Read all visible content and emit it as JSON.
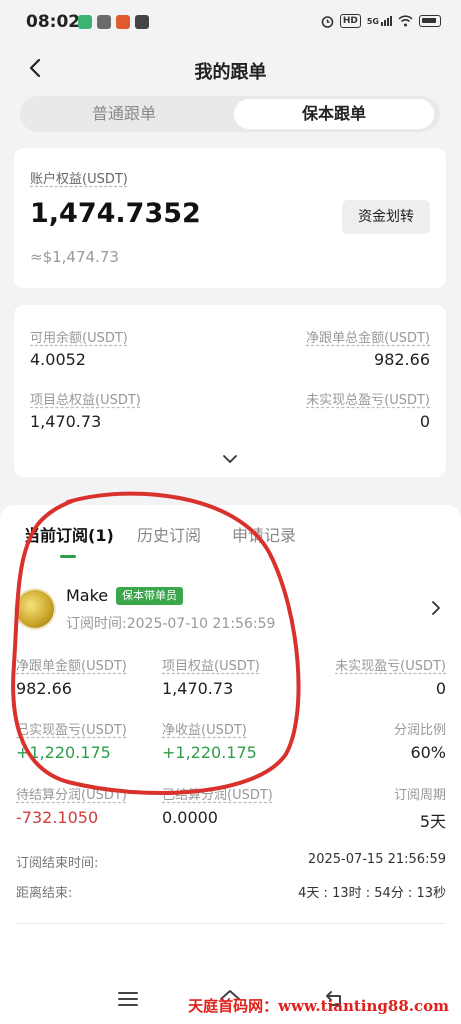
{
  "status_bar": {
    "time": "08:02",
    "right_icons": [
      "alarm-icon",
      "hd-icon",
      "5g-signal-icon",
      "wifi-icon",
      "battery-icon"
    ],
    "hd_label": "HD",
    "network_label": "5G"
  },
  "header": {
    "title": "我的跟单",
    "back_icon": "chevron-left-icon"
  },
  "segment": {
    "tabs": [
      {
        "label": "普通跟单",
        "active": false
      },
      {
        "label": "保本跟单",
        "active": true
      }
    ]
  },
  "account": {
    "equity_label": "账户权益(USDT)",
    "equity_value": "1,474.7352",
    "equity_approx": "≈$1,474.73",
    "transfer_button": "资金划转"
  },
  "stats": {
    "available_label": "可用余额(USDT)",
    "available_value": "4.0052",
    "net_total_label": "净跟单总金额(USDT)",
    "net_total_value": "982.66",
    "project_equity_label": "项目总权益(USDT)",
    "project_equity_value": "1,470.73",
    "unrealized_label": "未实现总盈亏(USDT)",
    "unrealized_value": "0",
    "expand_icon": "chevron-down-icon"
  },
  "orders": {
    "tabs": [
      {
        "label": "当前订阅(1)",
        "active": true
      },
      {
        "label": "历史订阅",
        "active": false
      },
      {
        "label": "申请记录",
        "active": false
      }
    ],
    "trader": {
      "name": "Make",
      "badge": "保本带单员",
      "subscribe_time": "订阅时间:2025-07-10 21:56:59"
    },
    "fields": {
      "net_amount_label": "净跟单金额(USDT)",
      "net_amount_value": "982.66",
      "project_equity_label": "项目权益(USDT)",
      "project_equity_value": "1,470.73",
      "unrealized_label": "未实现盈亏(USDT)",
      "unrealized_value": "0",
      "realized_label": "已实现盈亏(USDT)",
      "realized_value": "+1,220.175",
      "net_income_label": "净收益(USDT)",
      "net_income_value": "+1,220.175",
      "share_ratio_label": "分润比例",
      "share_ratio_value": "60%",
      "pending_share_label": "待结算分润(USDT)",
      "pending_share_value": "-732.1050",
      "settled_share_label": "已结算分润(USDT)",
      "settled_share_value": "0.0000",
      "period_label": "订阅周期",
      "period_value": "5天"
    },
    "end_time_label": "订阅结束时间:",
    "end_time_value": "2025-07-15 21:56:59",
    "countdown_label": "距离结束:",
    "countdown_value": "4天 : 13时 : 54分 : 13秒"
  },
  "navbar": {
    "icons": [
      "menu-icon",
      "home-icon",
      "back-nav-icon"
    ]
  },
  "watermark": "天庭首码网：www.tianting88.com",
  "colors": {
    "accent_green": "#2e9e4a",
    "loss_red": "#d23c3c",
    "badge_green": "#3aa74a",
    "annotation_red": "#d9312c"
  }
}
